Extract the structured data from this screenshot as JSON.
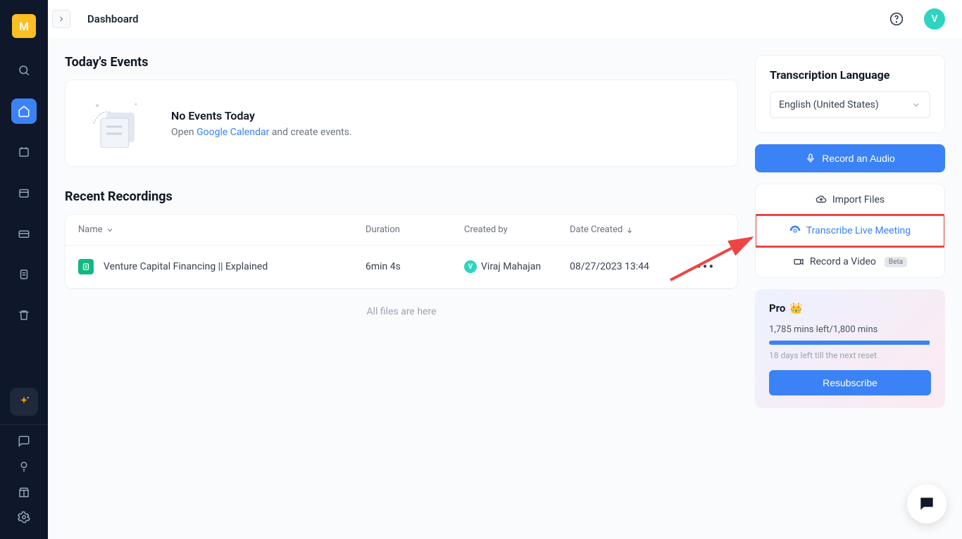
{
  "header": {
    "title": "Dashboard",
    "avatar_initial": "V",
    "logo_initial": "M"
  },
  "events": {
    "section_title": "Today's Events",
    "empty_title": "No Events Today",
    "empty_prefix": "Open ",
    "calendar_link": "Google Calendar",
    "empty_suffix": " and create events."
  },
  "recordings": {
    "section_title": "Recent Recordings",
    "columns": {
      "name": "Name",
      "duration": "Duration",
      "created_by": "Created by",
      "date": "Date Created"
    },
    "rows": [
      {
        "name": "Venture Capital Financing || Explained",
        "duration": "6min 4s",
        "creator": "Viraj Mahajan",
        "creator_initial": "V",
        "date": "08/27/2023 13:44"
      }
    ],
    "footer": "All files are here"
  },
  "language": {
    "title": "Transcription Language",
    "selected": "English (United States)"
  },
  "actions": {
    "record_audio": "Record an Audio",
    "import_files": "Import Files",
    "transcribe_live": "Transcribe Live Meeting",
    "record_video": "Record a Video",
    "beta_badge": "Beta"
  },
  "pro": {
    "title": "Pro",
    "mins": "1,785 mins left/1,800 mins",
    "days": "18 days left till the next reset",
    "button": "Resubscribe"
  }
}
